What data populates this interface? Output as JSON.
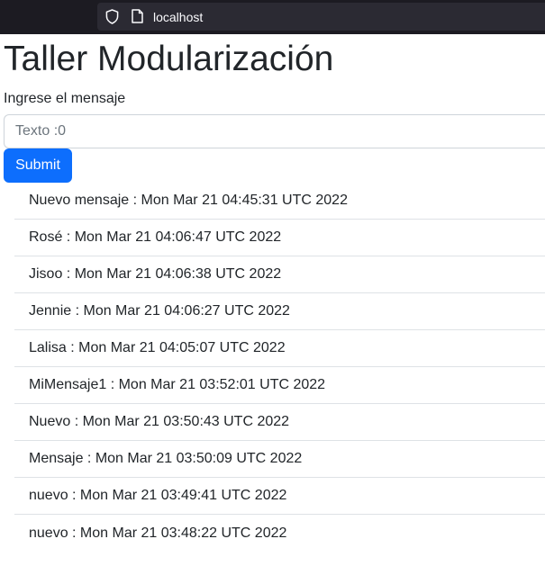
{
  "browser": {
    "url": "localhost",
    "icons": [
      "shield-icon",
      "page-icon"
    ]
  },
  "page": {
    "title": "Taller Modularización",
    "form": {
      "label": "Ingrese el mensaje",
      "input_placeholder": "Texto :0",
      "input_value": "",
      "submit_label": "Submit"
    },
    "messages": [
      "Nuevo mensaje : Mon Mar 21 04:45:31 UTC 2022",
      "Rosé : Mon Mar 21 04:06:47 UTC 2022",
      "Jisoo : Mon Mar 21 04:06:38 UTC 2022",
      "Jennie : Mon Mar 21 04:06:27 UTC 2022",
      "Lalisa : Mon Mar 21 04:05:07 UTC 2022",
      "MiMensaje1 : Mon Mar 21 03:52:01 UTC 2022",
      "Nuevo : Mon Mar 21 03:50:43 UTC 2022",
      "Mensaje : Mon Mar 21 03:50:09 UTC 2022",
      "nuevo : Mon Mar 21 03:49:41 UTC 2022",
      "nuevo : Mon Mar 21 03:48:22 UTC 2022"
    ]
  },
  "colors": {
    "browser_bg": "#1c1b22",
    "urlbar_bg": "#2b2a33",
    "primary": "#0d6efd",
    "text": "#212529",
    "border": "#dee2e6"
  }
}
